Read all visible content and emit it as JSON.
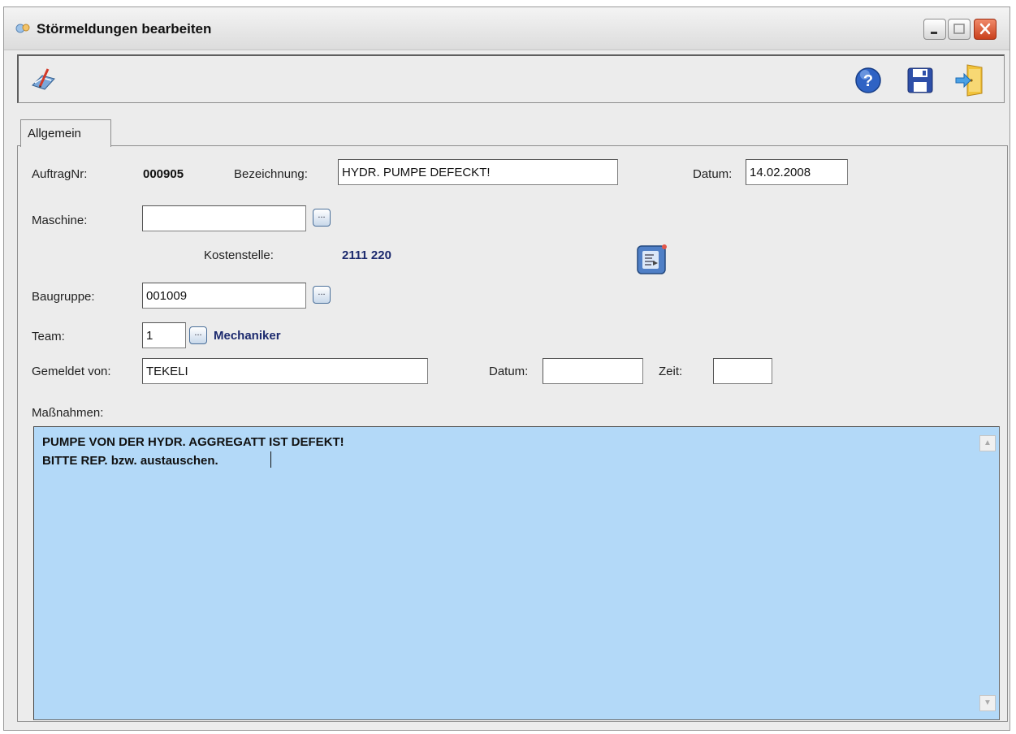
{
  "window": {
    "title": "Störmeldungen bearbeiten",
    "controls": {
      "minimize": "minimize",
      "maximize": "maximize",
      "close": "close"
    }
  },
  "toolbar": {
    "left_icon": "edit-document-icon",
    "right_icons": [
      "help-icon",
      "save-icon",
      "exit-door-icon"
    ]
  },
  "tabs": [
    {
      "label": "Allgemein",
      "active": true
    }
  ],
  "form": {
    "auftragnr": {
      "label": "AuftragNr:",
      "value": "000905"
    },
    "bezeichnung": {
      "label": "Bezeichnung:",
      "value": "HYDR. PUMPE DEFECKT!"
    },
    "datum_top": {
      "label": "Datum:",
      "value": "14.02.2008"
    },
    "maschine": {
      "label": "Maschine:",
      "value": "",
      "button": "..."
    },
    "kostenstelle": {
      "label": "Kostenstelle:",
      "value": "2111 220"
    },
    "baugruppe": {
      "label": "Baugruppe:",
      "value": "001009",
      "button": "..."
    },
    "team": {
      "label": "Team:",
      "value": "1",
      "button": "...",
      "name": "Mechaniker"
    },
    "gemeldet_von": {
      "label": "Gemeldet von:",
      "value": "TEKELI"
    },
    "datum": {
      "label": "Datum:",
      "value": ""
    },
    "zeit": {
      "label": "Zeit:",
      "value": ""
    },
    "massnahmen": {
      "label": "Maßnahmen:",
      "lines": [
        "PUMPE VON DER HYDR. AGGREGATT IST DEFEKT!",
        "BITTE REP. bzw. austauschen."
      ]
    }
  },
  "colors": {
    "textarea_bg": "#b3d9f8",
    "accent_blue": "#1c2a6e",
    "window_bg": "#ececec"
  }
}
